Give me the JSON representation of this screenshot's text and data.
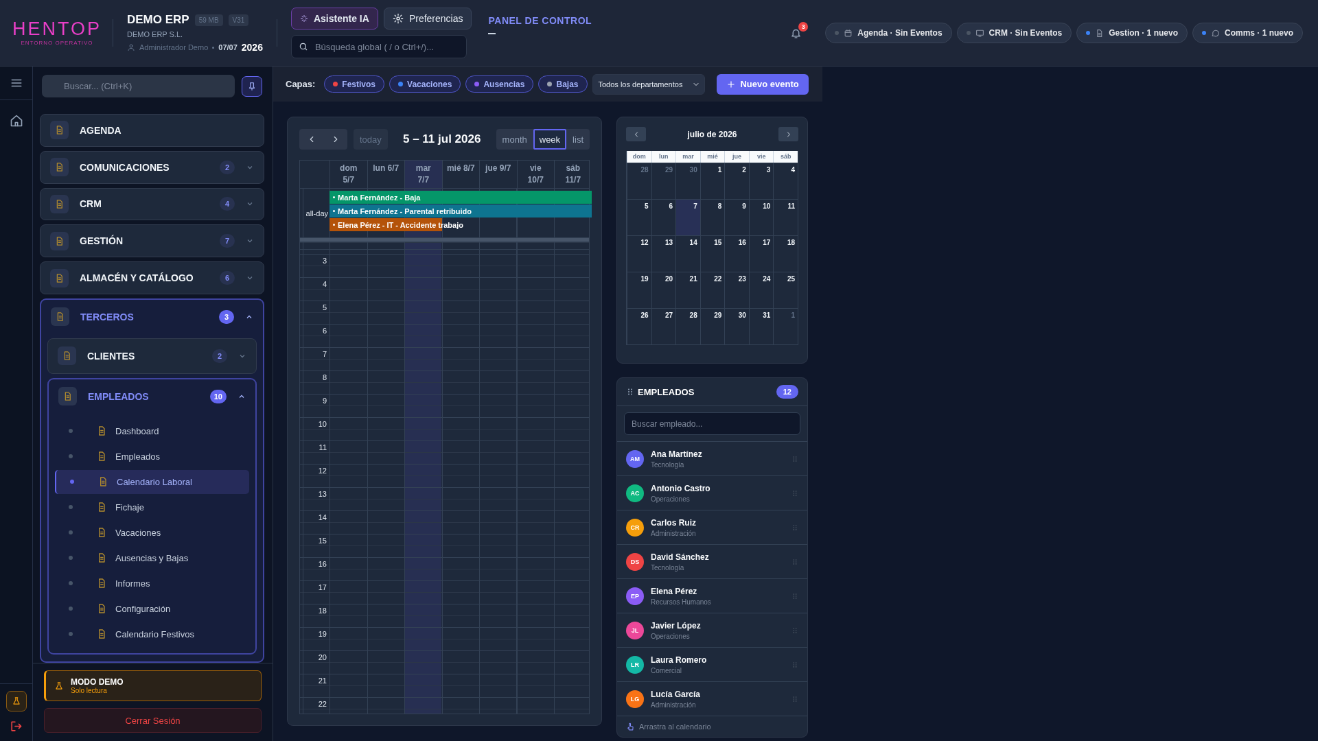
{
  "header": {
    "logo": {
      "name": "HENTOP",
      "tagline": "ENTORNO OPERATIVO"
    },
    "company": {
      "title": "DEMO ERP",
      "badges": [
        "59 MB",
        "V31"
      ],
      "legal_name": "DEMO ERP S.L.",
      "user": "Administrador Demo",
      "date": "07/07",
      "year": "2026"
    },
    "assistant_button": "Asistente IA",
    "preferences_button": "Preferencias",
    "search": {
      "placeholder": "Búsqueda global ( / o Ctrl+/)..."
    },
    "section_title": "PANEL DE CONTROL",
    "notifications": {
      "count": "3"
    },
    "status_pills": [
      {
        "label": "Agenda · Sin Eventos",
        "kind": "calendar",
        "active": false
      },
      {
        "label": "CRM · Sin Eventos",
        "kind": "screen",
        "active": false
      },
      {
        "label": "Gestion · 1 nuevo",
        "kind": "document",
        "active": true
      },
      {
        "label": "Comms · 1 nuevo",
        "kind": "chat",
        "active": true
      }
    ]
  },
  "sidebar": {
    "search": {
      "placeholder": "Buscar... (Ctrl+K)"
    },
    "items": [
      {
        "label": "AGENDA",
        "expanded": false
      },
      {
        "label": "COMUNICACIONES",
        "count": "2",
        "expanded": false
      },
      {
        "label": "CRM",
        "count": "4",
        "expanded": false
      },
      {
        "label": "GESTIÓN",
        "count": "7",
        "expanded": false
      },
      {
        "label": "ALMACÉN Y CATÁLOGO",
        "count": "6",
        "expanded": false
      },
      {
        "label": "TERCEROS",
        "count": "3",
        "expanded": true,
        "children": [
          {
            "label": "CLIENTES",
            "count": "2",
            "expanded": false
          },
          {
            "label": "EMPLEADOS",
            "count": "10",
            "expanded": true,
            "children": [
              {
                "label": "Dashboard",
                "selected": false
              },
              {
                "label": "Empleados",
                "selected": false
              },
              {
                "label": "Calendario Laboral",
                "selected": true
              },
              {
                "label": "Fichaje",
                "selected": false
              },
              {
                "label": "Vacaciones",
                "selected": false
              },
              {
                "label": "Ausencias y Bajas",
                "selected": false
              },
              {
                "label": "Informes",
                "selected": false
              },
              {
                "label": "Configuración",
                "selected": false
              },
              {
                "label": "Calendario Festivos",
                "selected": false
              }
            ]
          }
        ]
      }
    ],
    "demo": {
      "title": "MODO DEMO",
      "subtitle": "Solo lectura"
    },
    "logout": "Cerrar Sesión"
  },
  "toolbar": {
    "label": "Capas:",
    "layers": [
      {
        "label": "Festivos",
        "color": "#ef4444"
      },
      {
        "label": "Vacaciones",
        "color": "#3b82f6"
      },
      {
        "label": "Ausencias",
        "color": "#8b5cf6"
      },
      {
        "label": "Bajas",
        "color": "#9ca3af"
      }
    ],
    "department_select": "Todos los departamentos",
    "new_event_button": "Nuevo evento"
  },
  "calendar": {
    "title": "5 – 11 jul 2026",
    "today_button": "today",
    "views": [
      {
        "label": "month",
        "selected": false
      },
      {
        "label": "week",
        "selected": true
      },
      {
        "label": "list",
        "selected": false
      }
    ],
    "days": [
      {
        "label": "dom 5/7",
        "today": false
      },
      {
        "label": "lun 6/7",
        "today": false
      },
      {
        "label": "mar 7/7",
        "today": true
      },
      {
        "label": "mié 8/7",
        "today": false
      },
      {
        "label": "jue 9/7",
        "today": false
      },
      {
        "label": "vie 10/7",
        "today": false
      },
      {
        "label": "sáb 11/7",
        "today": false
      }
    ],
    "all_day_label": "all-day",
    "events": [
      {
        "title": "Marta Fernández - Baja",
        "color": "#059669",
        "days": [
          true,
          true,
          true,
          true,
          true,
          true,
          true
        ]
      },
      {
        "title": "Marta Fernández - Parental retribuido",
        "color": "#0e7490",
        "days": [
          true,
          true,
          true,
          true,
          true,
          true,
          true
        ]
      },
      {
        "title": "Elena Pérez - IT - Accidente trabajo",
        "color": "#b45309",
        "days": [
          true,
          true,
          true,
          false,
          false,
          false,
          false
        ]
      }
    ],
    "hours": [
      "3",
      "4",
      "5",
      "6",
      "7",
      "8",
      "9",
      "10",
      "11",
      "12",
      "13",
      "14",
      "15",
      "16",
      "17",
      "18",
      "19",
      "20",
      "21",
      "22"
    ]
  },
  "mini_calendar": {
    "title": "julio de 2026",
    "weekdays": [
      "dom",
      "lun",
      "mar",
      "mié",
      "jue",
      "vie",
      "sáb"
    ],
    "weeks": [
      [
        {
          "day": "28",
          "outside": true,
          "today": false
        },
        {
          "day": "29",
          "outside": true,
          "today": false
        },
        {
          "day": "30",
          "outside": true,
          "today": false
        },
        {
          "day": "1",
          "outside": false,
          "today": false
        },
        {
          "day": "2",
          "outside": false,
          "today": false
        },
        {
          "day": "3",
          "outside": false,
          "today": false
        },
        {
          "day": "4",
          "outside": false,
          "today": false
        }
      ],
      [
        {
          "day": "5",
          "outside": false,
          "today": false
        },
        {
          "day": "6",
          "outside": false,
          "today": false
        },
        {
          "day": "7",
          "outside": false,
          "today": true
        },
        {
          "day": "8",
          "outside": false,
          "today": false
        },
        {
          "day": "9",
          "outside": false,
          "today": false
        },
        {
          "day": "10",
          "outside": false,
          "today": false
        },
        {
          "day": "11",
          "outside": false,
          "today": false
        }
      ],
      [
        {
          "day": "12",
          "outside": false,
          "today": false
        },
        {
          "day": "13",
          "outside": false,
          "today": false
        },
        {
          "day": "14",
          "outside": false,
          "today": false
        },
        {
          "day": "15",
          "outside": false,
          "today": false
        },
        {
          "day": "16",
          "outside": false,
          "today": false
        },
        {
          "day": "17",
          "outside": false,
          "today": false
        },
        {
          "day": "18",
          "outside": false,
          "today": false
        }
      ],
      [
        {
          "day": "19",
          "outside": false,
          "today": false
        },
        {
          "day": "20",
          "outside": false,
          "today": false
        },
        {
          "day": "21",
          "outside": false,
          "today": false
        },
        {
          "day": "22",
          "outside": false,
          "today": false
        },
        {
          "day": "23",
          "outside": false,
          "today": false
        },
        {
          "day": "24",
          "outside": false,
          "today": false
        },
        {
          "day": "25",
          "outside": false,
          "today": false
        }
      ],
      [
        {
          "day": "26",
          "outside": false,
          "today": false
        },
        {
          "day": "27",
          "outside": false,
          "today": false
        },
        {
          "day": "28",
          "outside": false,
          "today": false
        },
        {
          "day": "29",
          "outside": false,
          "today": false
        },
        {
          "day": "30",
          "outside": false,
          "today": false
        },
        {
          "day": "31",
          "outside": false,
          "today": false
        },
        {
          "day": "1",
          "outside": true,
          "today": false
        }
      ]
    ]
  },
  "employees": {
    "title": "EMPLEADOS",
    "count": "12",
    "search": {
      "placeholder": "Buscar empleado..."
    },
    "items": [
      {
        "initials": "AM",
        "name": "Ana Martínez",
        "department": "Tecnología",
        "color": "#6366f1"
      },
      {
        "initials": "AC",
        "name": "Antonio Castro",
        "department": "Operaciones",
        "color": "#10b981"
      },
      {
        "initials": "CR",
        "name": "Carlos Ruiz",
        "department": "Administración",
        "color": "#f59e0b"
      },
      {
        "initials": "DS",
        "name": "David Sánchez",
        "department": "Tecnología",
        "color": "#ef4444"
      },
      {
        "initials": "EP",
        "name": "Elena Pérez",
        "department": "Recursos Humanos",
        "color": "#8b5cf6"
      },
      {
        "initials": "JL",
        "name": "Javier López",
        "department": "Operaciones",
        "color": "#ec4899"
      },
      {
        "initials": "LR",
        "name": "Laura Romero",
        "department": "Comercial",
        "color": "#14b8a6"
      },
      {
        "initials": "LG",
        "name": "Lucía García",
        "department": "Administración",
        "color": "#f97316"
      }
    ],
    "footer": "Arrastra al calendario"
  }
}
